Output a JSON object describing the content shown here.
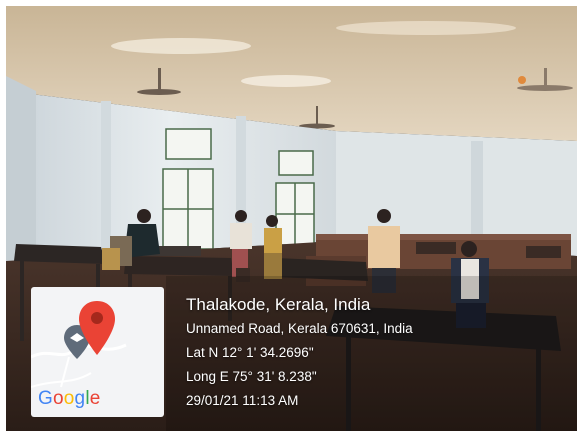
{
  "overlay": {
    "place": "Thalakode, Kerala, India",
    "address": "Unnamed Road, Kerala 670631, India",
    "latitude": "Lat N 12° 1' 34.2696\"",
    "longitude": "Long E 75° 31' 8.238\"",
    "datetime": "29/01/21 11:13 AM"
  },
  "map_card": {
    "logo_letters": [
      "G",
      "o",
      "o",
      "g",
      "l",
      "e"
    ],
    "logo_colors": [
      "#4285F4",
      "#EA4335",
      "#FBBC05",
      "#4285F4",
      "#34A853",
      "#EA4335"
    ],
    "pin_color": "#EA4335",
    "secondary_pin_color": "#5F6B7A"
  },
  "colors": {
    "ceiling": "#d8c7ad",
    "wall": "#dde3e6",
    "floor": "#3a2a22"
  }
}
